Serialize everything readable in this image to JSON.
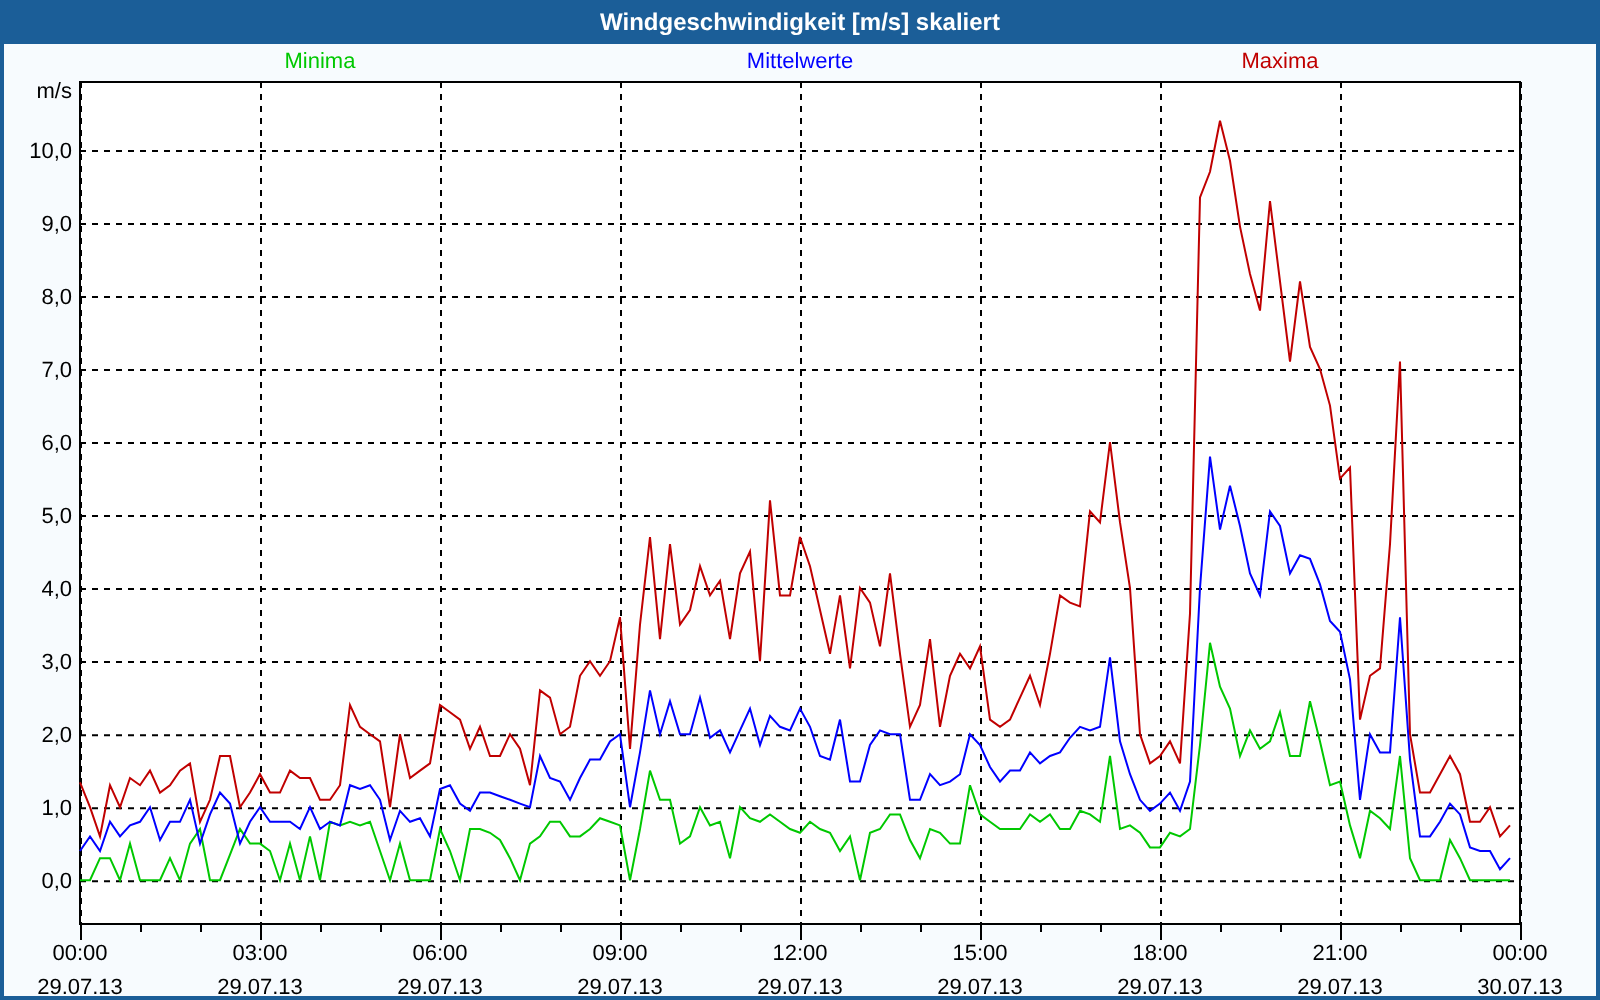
{
  "window": {
    "title": "Windgeschwindigkeit [m/s] skaliert"
  },
  "chart": {
    "chart_data": {
      "type": "line",
      "ylabel": "m/s",
      "ylim": [
        -0.6,
        10.93
      ],
      "grid": true,
      "categories": [
        "00:00\n29.07.13",
        null,
        null,
        null,
        null,
        null,
        null,
        null,
        null,
        null,
        null,
        null,
        null,
        null,
        null,
        null,
        null,
        null,
        "03:00\n29.07.13",
        null,
        null,
        null,
        null,
        null,
        null,
        null,
        null,
        null,
        null,
        null,
        null,
        null,
        null,
        null,
        null,
        null,
        "06:00\n29.07.13",
        null,
        null,
        null,
        null,
        null,
        null,
        null,
        null,
        null,
        null,
        null,
        null,
        null,
        null,
        null,
        null,
        null,
        "09:00\n29.07.13",
        null,
        null,
        null,
        null,
        null,
        null,
        null,
        null,
        null,
        null,
        null,
        null,
        null,
        null,
        null,
        null,
        null,
        "12:00\n29.07.13",
        null,
        null,
        null,
        null,
        null,
        null,
        null,
        null,
        null,
        null,
        null,
        null,
        null,
        null,
        null,
        null,
        null,
        "15:00\n29.07.13",
        null,
        null,
        null,
        null,
        null,
        null,
        null,
        null,
        null,
        null,
        null,
        null,
        null,
        null,
        null,
        null,
        null,
        "18:00\n29.07.13",
        null,
        null,
        null,
        null,
        null,
        null,
        null,
        null,
        null,
        null,
        null,
        null,
        null,
        null,
        null,
        null,
        null,
        "21:00\n29.07.13",
        null,
        null,
        null,
        null,
        null,
        null,
        null,
        null,
        null,
        null,
        null,
        null,
        null,
        null,
        null,
        null,
        null,
        "00:00\n30.07.13"
      ],
      "yticks": [
        {
          "value": 0,
          "label": "0,0"
        },
        {
          "value": 1,
          "label": "1,0"
        },
        {
          "value": 2,
          "label": "2,0"
        },
        {
          "value": 3,
          "label": "3,0"
        },
        {
          "value": 4,
          "label": "4,0"
        },
        {
          "value": 5,
          "label": "5,0"
        },
        {
          "value": 6,
          "label": "6,0"
        },
        {
          "value": 7,
          "label": "7,0"
        },
        {
          "value": 8,
          "label": "8,0"
        },
        {
          "value": 9,
          "label": "9,0"
        },
        {
          "value": 10,
          "label": "10,0"
        }
      ],
      "series": [
        {
          "name": "Minima",
          "color": "#00c800",
          "values": [
            0,
            0,
            0.3,
            0.3,
            0,
            0.5,
            0,
            0,
            0,
            0.3,
            0,
            0.5,
            0.7,
            0,
            0,
            0.35,
            0.7,
            0.5,
            0.5,
            0.4,
            0,
            0.5,
            0,
            0.6,
            0,
            0.8,
            0.75,
            0.8,
            0.75,
            0.8,
            0.4,
            0,
            0.5,
            0,
            0,
            0,
            0.7,
            0.4,
            0,
            0.7,
            0.7,
            0.65,
            0.55,
            0.3,
            0,
            0.5,
            0.6,
            0.8,
            0.8,
            0.6,
            0.6,
            0.7,
            0.85,
            0.8,
            0.75,
            0,
            0.7,
            1.5,
            1.1,
            1.1,
            0.5,
            0.6,
            1.0,
            0.75,
            0.8,
            0.3,
            1.0,
            0.85,
            0.8,
            0.9,
            0.8,
            0.7,
            0.65,
            0.8,
            0.7,
            0.65,
            0.4,
            0.6,
            0,
            0.65,
            0.7,
            0.9,
            0.9,
            0.55,
            0.3,
            0.7,
            0.65,
            0.5,
            0.5,
            1.3,
            0.9,
            0.8,
            0.7,
            0.7,
            0.7,
            0.9,
            0.8,
            0.9,
            0.7,
            0.7,
            0.95,
            0.9,
            0.8,
            1.7,
            0.7,
            0.75,
            0.65,
            0.45,
            0.45,
            0.65,
            0.6,
            0.7,
            1.85,
            3.25,
            2.65,
            2.35,
            1.7,
            2.05,
            1.8,
            1.9,
            2.3,
            1.7,
            1.7,
            2.45,
            1.9,
            1.3,
            1.35,
            0.75,
            0.3,
            0.95,
            0.85,
            0.7,
            1.7,
            0.3,
            0,
            0,
            0,
            0.55,
            0.3,
            0,
            0,
            0,
            0,
            0,
            null
          ]
        },
        {
          "name": "Mittelwerte",
          "color": "#0000ff",
          "values": [
            0.4,
            0.6,
            0.4,
            0.8,
            0.6,
            0.75,
            0.8,
            1.0,
            0.55,
            0.8,
            0.8,
            1.1,
            0.5,
            0.9,
            1.2,
            1.05,
            0.5,
            0.8,
            1.0,
            0.8,
            0.8,
            0.8,
            0.7,
            1.0,
            0.7,
            0.8,
            0.75,
            1.3,
            1.25,
            1.3,
            1.1,
            0.55,
            0.95,
            0.8,
            0.85,
            0.6,
            1.25,
            1.3,
            1.05,
            0.95,
            1.2,
            1.2,
            1.15,
            1.1,
            1.05,
            1.0,
            1.7,
            1.4,
            1.35,
            1.1,
            1.4,
            1.65,
            1.65,
            1.9,
            2.0,
            1.0,
            1.75,
            2.6,
            2.0,
            2.45,
            2.0,
            2.0,
            2.5,
            1.95,
            2.05,
            1.75,
            2.05,
            2.35,
            1.85,
            2.25,
            2.1,
            2.05,
            2.35,
            2.1,
            1.7,
            1.65,
            2.2,
            1.35,
            1.35,
            1.85,
            2.05,
            2.0,
            2.0,
            1.1,
            1.1,
            1.45,
            1.3,
            1.35,
            1.45,
            2.0,
            1.85,
            1.55,
            1.35,
            1.5,
            1.5,
            1.75,
            1.6,
            1.7,
            1.75,
            1.95,
            2.1,
            2.05,
            2.1,
            3.05,
            1.9,
            1.45,
            1.1,
            0.95,
            1.05,
            1.2,
            0.95,
            1.35,
            4.0,
            5.8,
            4.8,
            5.4,
            4.85,
            4.2,
            3.9,
            5.05,
            4.85,
            4.2,
            4.45,
            4.4,
            4.05,
            3.55,
            3.4,
            2.75,
            1.1,
            2.0,
            1.75,
            1.75,
            3.6,
            1.65,
            0.6,
            0.6,
            0.8,
            1.05,
            0.9,
            0.45,
            0.4,
            0.4,
            0.15,
            0.3,
            null
          ]
        },
        {
          "name": "Maxima",
          "color": "#c00000",
          "values": [
            1.34,
            1.0,
            0.6,
            1.3,
            1.0,
            1.4,
            1.3,
            1.5,
            1.2,
            1.3,
            1.5,
            1.6,
            0.8,
            1.1,
            1.7,
            1.7,
            1.0,
            1.2,
            1.45,
            1.2,
            1.2,
            1.5,
            1.4,
            1.4,
            1.1,
            1.1,
            1.3,
            2.4,
            2.1,
            2.0,
            1.9,
            1.0,
            2.0,
            1.4,
            1.5,
            1.6,
            2.4,
            2.3,
            2.2,
            1.8,
            2.1,
            1.7,
            1.7,
            2.0,
            1.8,
            1.3,
            2.6,
            2.5,
            2.0,
            2.1,
            2.8,
            3.0,
            2.8,
            3.0,
            3.6,
            1.8,
            3.5,
            4.7,
            3.3,
            4.6,
            3.5,
            3.7,
            4.3,
            3.9,
            4.1,
            3.3,
            4.2,
            4.5,
            3.0,
            5.2,
            3.9,
            3.9,
            4.7,
            4.3,
            3.7,
            3.1,
            3.9,
            2.9,
            4.0,
            3.8,
            3.2,
            4.2,
            3.1,
            2.1,
            2.4,
            3.3,
            2.1,
            2.8,
            3.1,
            2.9,
            3.2,
            2.2,
            2.1,
            2.2,
            2.5,
            2.8,
            2.4,
            3.1,
            3.9,
            3.8,
            3.75,
            5.05,
            4.9,
            6.0,
            4.9,
            4.0,
            2.0,
            1.6,
            1.7,
            1.9,
            1.6,
            3.65,
            9.35,
            9.7,
            10.4,
            9.85,
            8.95,
            8.3,
            7.8,
            9.3,
            8.2,
            7.1,
            8.2,
            7.3,
            7.0,
            6.5,
            5.5,
            5.65,
            2.2,
            2.8,
            2.9,
            4.6,
            7.1,
            2.0,
            1.2,
            1.2,
            1.45,
            1.7,
            1.45,
            0.8,
            0.8,
            1.0,
            0.6,
            0.75,
            null
          ]
        }
      ]
    }
  }
}
